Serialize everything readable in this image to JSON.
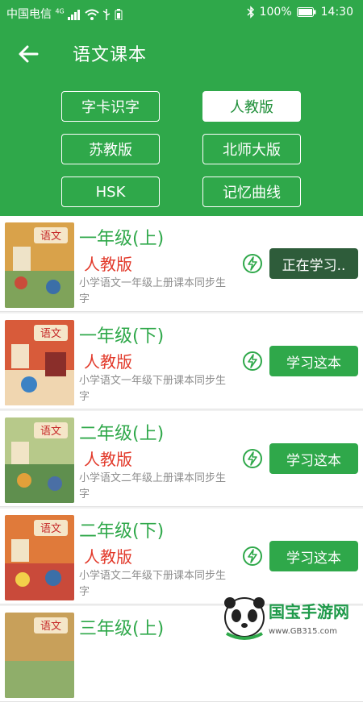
{
  "status_bar": {
    "carrier": "中国电信",
    "network": "4G",
    "battery": "100%",
    "time": "14:30"
  },
  "app_bar": {
    "title": "语文课本",
    "back_icon": "arrow-left-icon"
  },
  "filters": [
    {
      "label": "字卡识字",
      "active": false
    },
    {
      "label": "人教版",
      "active": true
    },
    {
      "label": "苏教版",
      "active": false
    },
    {
      "label": "北师大版",
      "active": false
    },
    {
      "label": "HSK",
      "active": false
    },
    {
      "label": "记忆曲线",
      "active": false
    }
  ],
  "books": [
    {
      "grade": "一年级(上)",
      "edition": "人教版",
      "desc": "小学语文一年级上册课本同步生字",
      "button": "正在学习..",
      "studying": true
    },
    {
      "grade": "一年级(下)",
      "edition": "人教版",
      "desc": "小学语文一年级下册课本同步生字",
      "button": "学习这本",
      "studying": false
    },
    {
      "grade": "二年级(上)",
      "edition": "人教版",
      "desc": "小学语文二年级上册课本同步生字",
      "button": "学习这本",
      "studying": false
    },
    {
      "grade": "二年级(下)",
      "edition": "人教版",
      "desc": "小学语文二年级下册课本同步生字",
      "button": "学习这本",
      "studying": false
    },
    {
      "grade": "三年级(上)",
      "edition": "",
      "desc": "",
      "button": "",
      "studying": false
    }
  ],
  "cover_text": "语文",
  "watermark": {
    "brand": "国宝手游网",
    "url": "www.GB315.com"
  },
  "colors": {
    "primary": "#2fa84a",
    "studying": "#2e5c3a",
    "edition": "#e23a2b",
    "desc": "#8d8d8d"
  }
}
